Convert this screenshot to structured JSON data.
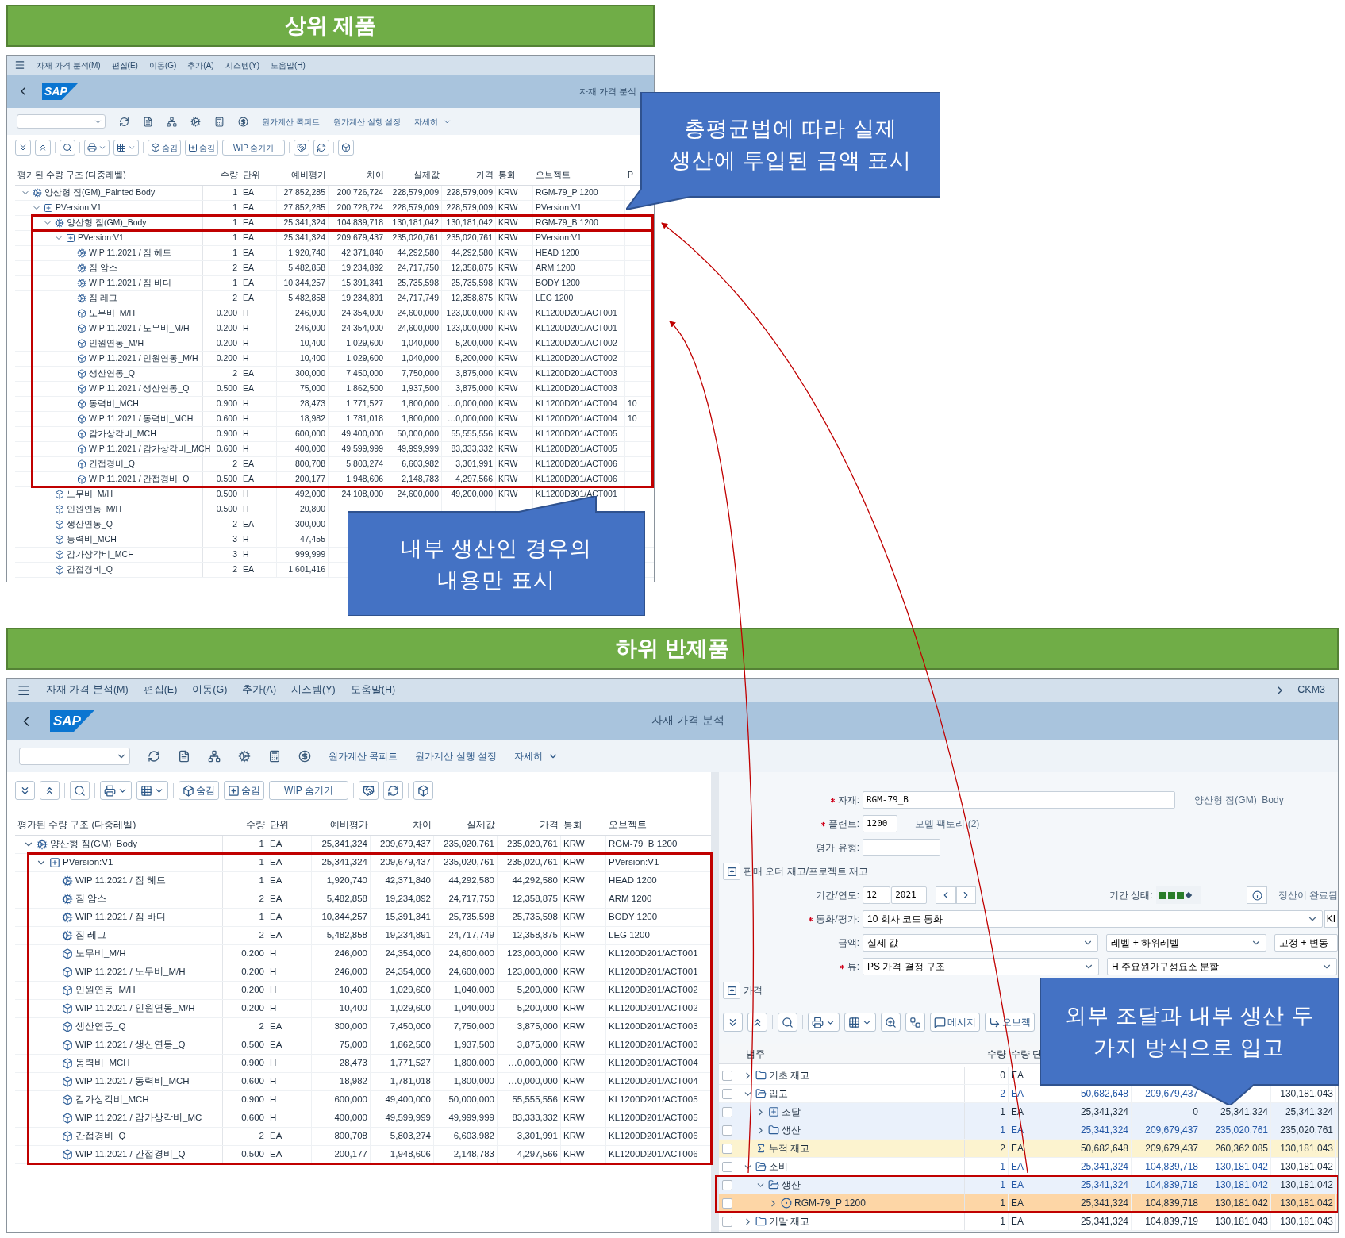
{
  "top_banner": "상위 제품",
  "top_window": {
    "menu": [
      "자재 가격 분석(M)",
      "편집(E)",
      "이동(G)",
      "추가(A)",
      "시스템(Y)",
      "도움말(H)"
    ],
    "logo": "SAP",
    "title": "자재 가격 분석",
    "links": [
      "원가계산 콕피트",
      "원가계산 실행 설정",
      "자세히"
    ],
    "tree_buttons": [
      "숨김",
      "숨김",
      "WIP 숨기기"
    ],
    "columns": [
      "평가된 수량 구조 (다중레벨)",
      "수량",
      "단위",
      "예비평가",
      "차이",
      "실제값",
      "가격",
      "통화",
      "오브젝트",
      "P"
    ],
    "rows": [
      {
        "kind": "material",
        "expanded": true,
        "cells": [
          "양산형 짐(GM)_Painted Body",
          "1",
          "EA",
          "27,852,285",
          "200,726,724",
          "228,579,009",
          "228,579,009",
          "KRW",
          "RGM-79_P 1200"
        ],
        "children": [
          {
            "kind": "version",
            "expanded": true,
            "cells": [
              "PVersion:V1",
              "1",
              "EA",
              "27,852,285",
              "200,726,724",
              "228,579,009",
              "228,579,009",
              "KRW",
              "PVersion:V1"
            ],
            "children": [
              {
                "kind": "material",
                "expanded": true,
                "framed": true,
                "cells": [
                  "양산형 짐(GM)_Body",
                  "1",
                  "EA",
                  "25,341,324",
                  "104,839,718",
                  "130,181,042",
                  "130,181,042",
                  "KRW",
                  "RGM-79_B 1200"
                ],
                "children": [
                  {
                    "kind": "version",
                    "expanded": true,
                    "framed": true,
                    "cells": [
                      "PVersion:V1",
                      "1",
                      "EA",
                      "25,341,324",
                      "209,679,437",
                      "235,020,761",
                      "235,020,761",
                      "KRW",
                      "PVersion:V1"
                    ],
                    "children": [
                      {
                        "kind": "material",
                        "cells": [
                          "WIP 11.2021 / 짐 헤드",
                          "1",
                          "EA",
                          "1,920,740",
                          "42,371,840",
                          "44,292,580",
                          "44,292,580",
                          "KRW",
                          "HEAD 1200"
                        ]
                      },
                      {
                        "kind": "material",
                        "cells": [
                          "짐 암스",
                          "2",
                          "EA",
                          "5,482,858",
                          "19,234,892",
                          "24,717,750",
                          "12,358,875",
                          "KRW",
                          "ARM 1200"
                        ]
                      },
                      {
                        "kind": "material",
                        "cells": [
                          "WIP 11.2021 / 짐 바디",
                          "1",
                          "EA",
                          "10,344,257",
                          "15,391,341",
                          "25,735,598",
                          "25,735,598",
                          "KRW",
                          "BODY 1200"
                        ]
                      },
                      {
                        "kind": "material",
                        "cells": [
                          "짐 레그",
                          "2",
                          "EA",
                          "5,482,858",
                          "19,234,891",
                          "24,717,749",
                          "12,358,875",
                          "KRW",
                          "LEG 1200"
                        ]
                      },
                      {
                        "kind": "activity",
                        "cells": [
                          "노무비_M/H",
                          "0.200",
                          "H",
                          "246,000",
                          "24,354,000",
                          "24,600,000",
                          "123,000,000",
                          "KRW",
                          "KL1200D201/ACT001"
                        ]
                      },
                      {
                        "kind": "activity",
                        "cells": [
                          "WIP 11.2021 / 노무비_M/H",
                          "0.200",
                          "H",
                          "246,000",
                          "24,354,000",
                          "24,600,000",
                          "123,000,000",
                          "KRW",
                          "KL1200D201/ACT001"
                        ]
                      },
                      {
                        "kind": "activity",
                        "cells": [
                          "인원연동_M/H",
                          "0.200",
                          "H",
                          "10,400",
                          "1,029,600",
                          "1,040,000",
                          "5,200,000",
                          "KRW",
                          "KL1200D201/ACT002"
                        ]
                      },
                      {
                        "kind": "activity",
                        "cells": [
                          "WIP 11.2021 / 인원연동_M/H",
                          "0.200",
                          "H",
                          "10,400",
                          "1,029,600",
                          "1,040,000",
                          "5,200,000",
                          "KRW",
                          "KL1200D201/ACT002"
                        ]
                      },
                      {
                        "kind": "activity",
                        "cells": [
                          "생산연동_Q",
                          "2",
                          "EA",
                          "300,000",
                          "7,450,000",
                          "7,750,000",
                          "3,875,000",
                          "KRW",
                          "KL1200D201/ACT003"
                        ]
                      },
                      {
                        "kind": "activity",
                        "cells": [
                          "WIP 11.2021 / 생산연동_Q",
                          "0.500",
                          "EA",
                          "75,000",
                          "1,862,500",
                          "1,937,500",
                          "3,875,000",
                          "KRW",
                          "KL1200D201/ACT003"
                        ]
                      },
                      {
                        "kind": "activity",
                        "cells": [
                          "동력비_MCH",
                          "0.900",
                          "H",
                          "28,473",
                          "1,771,527",
                          "1,800,000",
                          "…0,000,000",
                          "KRW",
                          "KL1200D201/ACT004",
                          "10"
                        ]
                      },
                      {
                        "kind": "activity",
                        "cells": [
                          "WIP 11.2021 / 동력비_MCH",
                          "0.600",
                          "H",
                          "18,982",
                          "1,781,018",
                          "1,800,000",
                          "…0,000,000",
                          "KRW",
                          "KL1200D201/ACT004",
                          "10"
                        ]
                      },
                      {
                        "kind": "activity",
                        "cells": [
                          "감가상각비_MCH",
                          "0.900",
                          "H",
                          "600,000",
                          "49,400,000",
                          "50,000,000",
                          "55,555,556",
                          "KRW",
                          "KL1200D201/ACT005"
                        ]
                      },
                      {
                        "kind": "activity",
                        "cells": [
                          "WIP 11.2021 / 감가상각비_MCH",
                          "0.600",
                          "H",
                          "400,000",
                          "49,599,999",
                          "49,999,999",
                          "83,333,332",
                          "KRW",
                          "KL1200D201/ACT005"
                        ]
                      },
                      {
                        "kind": "activity",
                        "cells": [
                          "간접경비_Q",
                          "2",
                          "EA",
                          "800,708",
                          "5,803,274",
                          "6,603,982",
                          "3,301,991",
                          "KRW",
                          "KL1200D201/ACT006"
                        ]
                      },
                      {
                        "kind": "activity",
                        "cells": [
                          "WIP 11.2021 / 간접경비_Q",
                          "0.500",
                          "EA",
                          "200,177",
                          "1,948,606",
                          "2,148,783",
                          "4,297,566",
                          "KRW",
                          "KL1200D201/ACT006"
                        ]
                      }
                    ]
                  }
                ]
              },
              {
                "kind": "activity",
                "cells": [
                  "노무비_M/H",
                  "0.500",
                  "H",
                  "492,000",
                  "24,108,000",
                  "24,600,000",
                  "49,200,000",
                  "KRW",
                  "KL1200D301/ACT001"
                ]
              },
              {
                "kind": "activity",
                "cells": [
                  "인원연동_M/H",
                  "0.500",
                  "H",
                  "20,800"
                ]
              },
              {
                "kind": "activity",
                "cells": [
                  "생산연동_Q",
                  "2",
                  "EA",
                  "300,000"
                ]
              },
              {
                "kind": "activity",
                "cells": [
                  "동력비_MCH",
                  "3",
                  "H",
                  "47,455"
                ]
              },
              {
                "kind": "activity",
                "cells": [
                  "감가상각비_MCH",
                  "3",
                  "H",
                  "999,999"
                ]
              },
              {
                "kind": "activity",
                "cells": [
                  "간접경비_Q",
                  "2",
                  "EA",
                  "1,601,416"
                ]
              }
            ]
          }
        ]
      }
    ]
  },
  "callouts": [
    {
      "lines": [
        "총평균법에 따라 실제",
        "생산에 투입된 금액 표시"
      ]
    },
    {
      "lines": [
        "내부 생산인 경우의",
        "내용만 표시"
      ]
    },
    {
      "lines": [
        "외부 조달과 내부 생산 두",
        "가지 방식으로 입고"
      ]
    }
  ],
  "bottom_banner": "하위 반제품",
  "bottom_window": {
    "menu": [
      "자재 가격 분석(M)",
      "편집(E)",
      "이동(G)",
      "추가(A)",
      "시스템(Y)",
      "도움말(H)"
    ],
    "transaction": "CKM3",
    "logo": "SAP",
    "title": "자재 가격 분석",
    "links": [
      "원가계산 콕피트",
      "원가계산 실행 설정",
      "자세히"
    ],
    "tree_buttons": [
      "숨김",
      "숨김",
      "WIP 숨기기"
    ],
    "columns": [
      "평가된 수량 구조 (다중레벨)",
      "수량",
      "단위",
      "예비평가",
      "차이",
      "실제값",
      "가격",
      "통화",
      "오브젝트"
    ],
    "rows": [
      {
        "kind": "material",
        "expanded": true,
        "cells": [
          "양산형 짐(GM)_Body",
          "1",
          "EA",
          "25,341,324",
          "209,679,437",
          "235,020,761",
          "235,020,761",
          "KRW",
          "RGM-79_B 1200"
        ],
        "children": [
          {
            "kind": "version",
            "expanded": true,
            "framed": true,
            "cells": [
              "PVersion:V1",
              "1",
              "EA",
              "25,341,324",
              "209,679,437",
              "235,020,761",
              "235,020,761",
              "KRW",
              "PVersion:V1"
            ],
            "children": [
              {
                "kind": "material",
                "cells": [
                  "WIP 11.2021 / 짐 헤드",
                  "1",
                  "EA",
                  "1,920,740",
                  "42,371,840",
                  "44,292,580",
                  "44,292,580",
                  "KRW",
                  "HEAD 1200"
                ]
              },
              {
                "kind": "material",
                "cells": [
                  "짐 암스",
                  "2",
                  "EA",
                  "5,482,858",
                  "19,234,892",
                  "24,717,750",
                  "12,358,875",
                  "KRW",
                  "ARM 1200"
                ]
              },
              {
                "kind": "material",
                "cells": [
                  "WIP 11.2021 / 짐 바디",
                  "1",
                  "EA",
                  "10,344,257",
                  "15,391,341",
                  "25,735,598",
                  "25,735,598",
                  "KRW",
                  "BODY 1200"
                ]
              },
              {
                "kind": "material",
                "cells": [
                  "짐 레그",
                  "2",
                  "EA",
                  "5,482,858",
                  "19,234,891",
                  "24,717,749",
                  "12,358,875",
                  "KRW",
                  "LEG 1200"
                ]
              },
              {
                "kind": "activity",
                "cells": [
                  "노무비_M/H",
                  "0.200",
                  "H",
                  "246,000",
                  "24,354,000",
                  "24,600,000",
                  "123,000,000",
                  "KRW",
                  "KL1200D201/ACT001"
                ]
              },
              {
                "kind": "activity",
                "cells": [
                  "WIP 11.2021 / 노무비_M/H",
                  "0.200",
                  "H",
                  "246,000",
                  "24,354,000",
                  "24,600,000",
                  "123,000,000",
                  "KRW",
                  "KL1200D201/ACT001"
                ]
              },
              {
                "kind": "activity",
                "cells": [
                  "인원연동_M/H",
                  "0.200",
                  "H",
                  "10,400",
                  "1,029,600",
                  "1,040,000",
                  "5,200,000",
                  "KRW",
                  "KL1200D201/ACT002"
                ]
              },
              {
                "kind": "activity",
                "cells": [
                  "WIP 11.2021 / 인원연동_M/H",
                  "0.200",
                  "H",
                  "10,400",
                  "1,029,600",
                  "1,040,000",
                  "5,200,000",
                  "KRW",
                  "KL1200D201/ACT002"
                ]
              },
              {
                "kind": "activity",
                "cells": [
                  "생산연동_Q",
                  "2",
                  "EA",
                  "300,000",
                  "7,450,000",
                  "7,750,000",
                  "3,875,000",
                  "KRW",
                  "KL1200D201/ACT003"
                ]
              },
              {
                "kind": "activity",
                "cells": [
                  "WIP 11.2021 / 생산연동_Q",
                  "0.500",
                  "EA",
                  "75,000",
                  "1,862,500",
                  "1,937,500",
                  "3,875,000",
                  "KRW",
                  "KL1200D201/ACT003"
                ]
              },
              {
                "kind": "activity",
                "cells": [
                  "동력비_MCH",
                  "0.900",
                  "H",
                  "28,473",
                  "1,771,527",
                  "1,800,000",
                  "…0,000,000",
                  "KRW",
                  "KL1200D201/ACT004"
                ]
              },
              {
                "kind": "activity",
                "cells": [
                  "WIP 11.2021 / 동력비_MCH",
                  "0.600",
                  "H",
                  "18,982",
                  "1,781,018",
                  "1,800,000",
                  "…0,000,000",
                  "KRW",
                  "KL1200D201/ACT004"
                ]
              },
              {
                "kind": "activity",
                "cells": [
                  "감가상각비_MCH",
                  "0.900",
                  "H",
                  "600,000",
                  "49,400,000",
                  "50,000,000",
                  "55,555,556",
                  "KRW",
                  "KL1200D201/ACT005"
                ]
              },
              {
                "kind": "activity",
                "cells": [
                  "WIP 11.2021 / 감가상각비_MC",
                  "0.600",
                  "H",
                  "400,000",
                  "49,599,999",
                  "49,999,999",
                  "83,333,332",
                  "KRW",
                  "KL1200D201/ACT005"
                ]
              },
              {
                "kind": "activity",
                "cells": [
                  "간접경비_Q",
                  "2",
                  "EA",
                  "800,708",
                  "5,803,274",
                  "6,603,982",
                  "3,301,991",
                  "KRW",
                  "KL1200D201/ACT006"
                ]
              },
              {
                "kind": "activity",
                "cells": [
                  "WIP 11.2021 / 간접경비_Q",
                  "0.500",
                  "EA",
                  "200,177",
                  "1,948,606",
                  "2,148,783",
                  "4,297,566",
                  "KRW",
                  "KL1200D201/ACT006"
                ]
              }
            ]
          }
        ]
      }
    ],
    "form": [
      {
        "kind": "input",
        "label": "자재:",
        "required": true,
        "value": "RGM-79_B",
        "note": "양산형 짐(GM)_Body"
      },
      {
        "kind": "input",
        "label": "플랜트:",
        "required": true,
        "value": "1200",
        "note": "모델 팩토리 (2)"
      },
      {
        "kind": "input",
        "label": "평가 유형:",
        "required": false
      },
      {
        "kind": "toggle",
        "label": "판매 오더 재고/프로젝트 재고"
      },
      {
        "kind": "period",
        "label": "기간/연도:",
        "required": false,
        "values": [
          "12",
          "2021"
        ],
        "status_label": "기간 상태:",
        "status_text": "정산이 완료됨"
      },
      {
        "kind": "select",
        "label": "통화/평가:",
        "required": true,
        "selects": [
          "10 회사 코드 통화"
        ],
        "extra": "KI"
      },
      {
        "kind": "select",
        "label": "금액:",
        "required": false,
        "selects": [
          "실제 값",
          "레벨 + 하위레벨",
          "고정 + 변동"
        ]
      },
      {
        "kind": "select",
        "label": "뷰:",
        "required": true,
        "selects": [
          "PS 가격 결정 구조",
          "H 주요원가구성요소 분할"
        ]
      },
      {
        "kind": "toggle",
        "label": "가격"
      }
    ],
    "price_toolbar": [
      "메시지",
      "오브젝"
    ],
    "price_columns": [
      "범주",
      "수량",
      "수량 단"
    ],
    "price_rows": [
      {
        "kind": "folder",
        "label": "기초 재고",
        "expanded": false,
        "checked": false,
        "selected": false,
        "linked": false,
        "cells": [
          "0",
          "EA"
        ]
      },
      {
        "kind": "folder",
        "label": "입고",
        "expanded": true,
        "checked": false,
        "selected": false,
        "linked": true,
        "cells": [
          "2",
          "EA",
          "50,682,648",
          "209,679,437",
          null,
          "130,181,043"
        ],
        "children": [
          {
            "kind": "procure",
            "label": "조달",
            "expanded": false,
            "checked": false,
            "selected": false,
            "linked": false,
            "cells": [
              "1",
              "EA",
              "25,341,324",
              "0",
              "25,341,324",
              "25,341,324"
            ]
          },
          {
            "kind": "folder",
            "label": "생산",
            "expanded": false,
            "checked": false,
            "selected": false,
            "linked": true,
            "cells": [
              "1",
              "EA",
              "25,341,324",
              "209,679,437",
              "235,020,761",
              "235,020,761"
            ]
          }
        ]
      },
      {
        "kind": "sum",
        "label": "누적 재고",
        "checked": false,
        "selected": false,
        "linked": false,
        "cells": [
          "2",
          "EA",
          "50,682,648",
          "209,679,437",
          "260,362,085",
          "130,181,043"
        ]
      },
      {
        "kind": "folder",
        "label": "소비",
        "expanded": true,
        "checked": false,
        "selected": false,
        "linked": true,
        "cells": [
          "1",
          "EA",
          "25,341,324",
          "104,839,718",
          "130,181,042",
          "130,181,042"
        ],
        "children": [
          {
            "kind": "folder",
            "label": "생산",
            "expanded": true,
            "checked": false,
            "selected": false,
            "linked": true,
            "framed": true,
            "cells": [
              "1",
              "EA",
              "25,341,324",
              "104,839,718",
              "130,181,042",
              "130,181,042"
            ],
            "children": [
              {
                "kind": "material",
                "label": "RGM-79_P 1200",
                "expanded": false,
                "checked": false,
                "selected": true,
                "linked": false,
                "cells": [
                  "1",
                  "EA",
                  "25,341,324",
                  "104,839,718",
                  "130,181,042",
                  "130,181,042"
                ]
              }
            ]
          }
        ]
      },
      {
        "kind": "folder",
        "label": "기말 재고",
        "expanded": false,
        "checked": false,
        "selected": false,
        "linked": false,
        "cells": [
          "1",
          "EA",
          "25,341,324",
          "104,839,719",
          "130,181,043",
          "130,181,043"
        ]
      }
    ]
  }
}
